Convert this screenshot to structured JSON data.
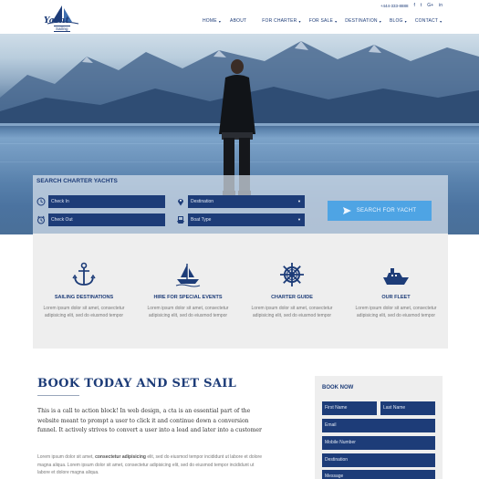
{
  "brand": {
    "name": "Yacht",
    "tagline": "Sailing"
  },
  "header": {
    "phone": "+444-333-8888",
    "social": [
      "facebook-icon",
      "twitter-icon",
      "google-plus-icon",
      "linkedin-icon"
    ],
    "nav": [
      {
        "label": "HOME",
        "caret": true
      },
      {
        "label": "ABOUT",
        "caret": false
      },
      {
        "label": "FOR CHARTER",
        "caret": true
      },
      {
        "label": "FOR SALE",
        "caret": true
      },
      {
        "label": "DESTINATION",
        "caret": true
      },
      {
        "label": "BLOG",
        "caret": true
      },
      {
        "label": "CONTACT",
        "caret": true
      }
    ]
  },
  "search": {
    "title": "SEARCH CHARTER YACHTS",
    "check_in": "Check In",
    "check_out": "Check Out",
    "destination": "Destination",
    "boat_type": "Boat Type",
    "button": "SEARCH FOR YACHT"
  },
  "features": [
    {
      "icon": "anchor-icon",
      "title": "SAILING DESTINATIONS",
      "text": "Lorem ipsum dolor sit amet, consectetur adipisicing elit, sed do eiusmod tempor"
    },
    {
      "icon": "sailboat-icon",
      "title": "HIRE FOR SPECIAL EVENTS",
      "text": "Lorem ipsum dolor sit amet, consectetur adipisicing elit, sed do eiusmod tempor"
    },
    {
      "icon": "ship-wheel-icon",
      "title": "CHARTER GUIDE",
      "text": "Lorem ipsum dolor sit amet, consectetur adipisicing elit, sed do eiusmod tempor"
    },
    {
      "icon": "motor-yacht-icon",
      "title": "OUR FLEET",
      "text": "Lorem ipsum dolor sit amet, consectetur adipisicing elit, sed do eiusmod tempor"
    }
  ],
  "cta": {
    "title": "BOOK TODAY AND SET SAIL",
    "paragraph": "This is a call to action block! In web design, a cta is an essential part of the website meant to prompt a user to click it and continue down a conversion funnel. It actively strives to convert a user into a lead and later into a customer",
    "lorem_start": "Lorem ipsum dolor sit amet, ",
    "lorem_bold": "consectetur adipisicing",
    "lorem_end": " elit, sed do eiusmod tempor incididunt ut labore et dolore magna aliqua. Lorem ipsum dolor sit amet, consectetur adipisicing elit, sed do eiusmod tempor incididunt ut labore et dolore magna aliqua."
  },
  "booking": {
    "title": "BOOK NOW",
    "first_name": "First Name",
    "last_name": "Last Name",
    "email": "Email",
    "mobile": "Mobile Number",
    "destination": "Destination",
    "message": "Message"
  },
  "colors": {
    "navy": "#1d3c78",
    "accent_blue": "#4ea4e4",
    "panel_gray": "#eeeeee"
  }
}
